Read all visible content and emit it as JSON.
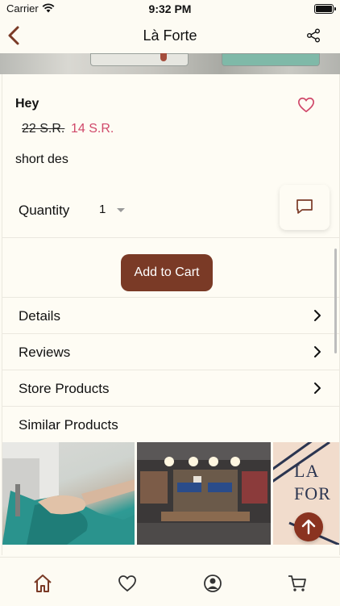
{
  "status_bar": {
    "carrier": "Carrier",
    "time": "9:32 PM",
    "wifi_icon": "wifi-icon",
    "battery_icon": "battery-icon"
  },
  "nav": {
    "title": "Là Forte",
    "back_icon": "chevron-left-icon",
    "share_icon": "share-icon"
  },
  "product": {
    "name": "Hey",
    "old_price": "22 S.R.",
    "new_price": "14 S.R.",
    "short_description": "short des",
    "favorite_icon": "heart-outline-icon"
  },
  "quantity": {
    "label": "Quantity",
    "value": "1"
  },
  "actions": {
    "add_to_cart": "Add to Cart",
    "chat_icon": "chat-icon",
    "scroll_top_icon": "arrow-up-icon"
  },
  "menu": [
    {
      "label": "Details"
    },
    {
      "label": "Reviews"
    },
    {
      "label": "Store Products"
    },
    {
      "label": "Similar Products"
    }
  ],
  "similar_products": [
    {
      "image": "sewing-machine-fabric-image"
    },
    {
      "image": "clothing-store-interior-image"
    },
    {
      "image": "la-forte-logo-image",
      "text_line1": "LA",
      "text_line2": "FOR"
    }
  ],
  "tab_bar": [
    {
      "icon": "home-icon",
      "active": true
    },
    {
      "icon": "heart-icon",
      "active": false
    },
    {
      "icon": "profile-icon",
      "active": false
    },
    {
      "icon": "cart-icon",
      "active": false
    }
  ],
  "colors": {
    "accent": "#7a3a26",
    "sale_price": "#d0486a",
    "favorite": "#d0486a",
    "background": "#fdfbf3"
  }
}
